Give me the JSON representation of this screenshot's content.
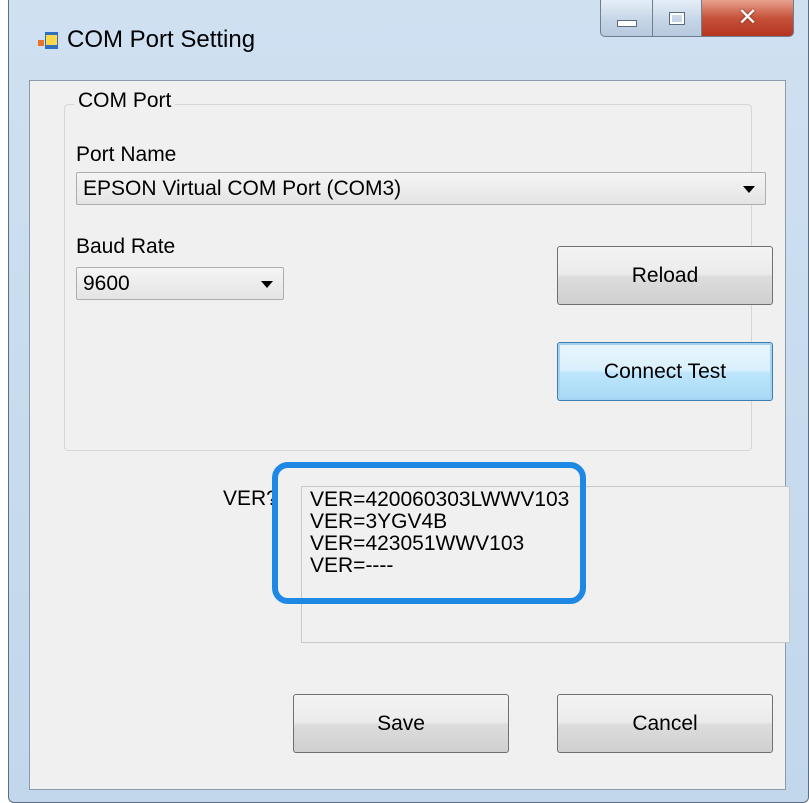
{
  "window": {
    "title": "COM Port Setting",
    "icon": "app-window-icon",
    "controls": {
      "minimize_icon": "minimize-icon",
      "maximize_icon": "maximize-icon",
      "close_icon": "close-icon"
    }
  },
  "com_port_group": {
    "legend": "COM Port",
    "port_name": {
      "label": "Port Name",
      "value": "EPSON Virtual COM Port (COM3)"
    },
    "baud_rate": {
      "label": "Baud Rate",
      "value": "9600"
    },
    "reload_label": "Reload",
    "connect_test_label": "Connect Test"
  },
  "version": {
    "label": "VER?",
    "lines": [
      "VER=420060303LWWV103",
      "VER=3YGV4B",
      "VER=423051WWV103",
      "VER=----"
    ]
  },
  "footer": {
    "save_label": "Save",
    "cancel_label": "Cancel"
  },
  "colors": {
    "highlight": "#1e88e5",
    "close_button": "#c6523a",
    "focus_border": "#3c7fb1"
  }
}
